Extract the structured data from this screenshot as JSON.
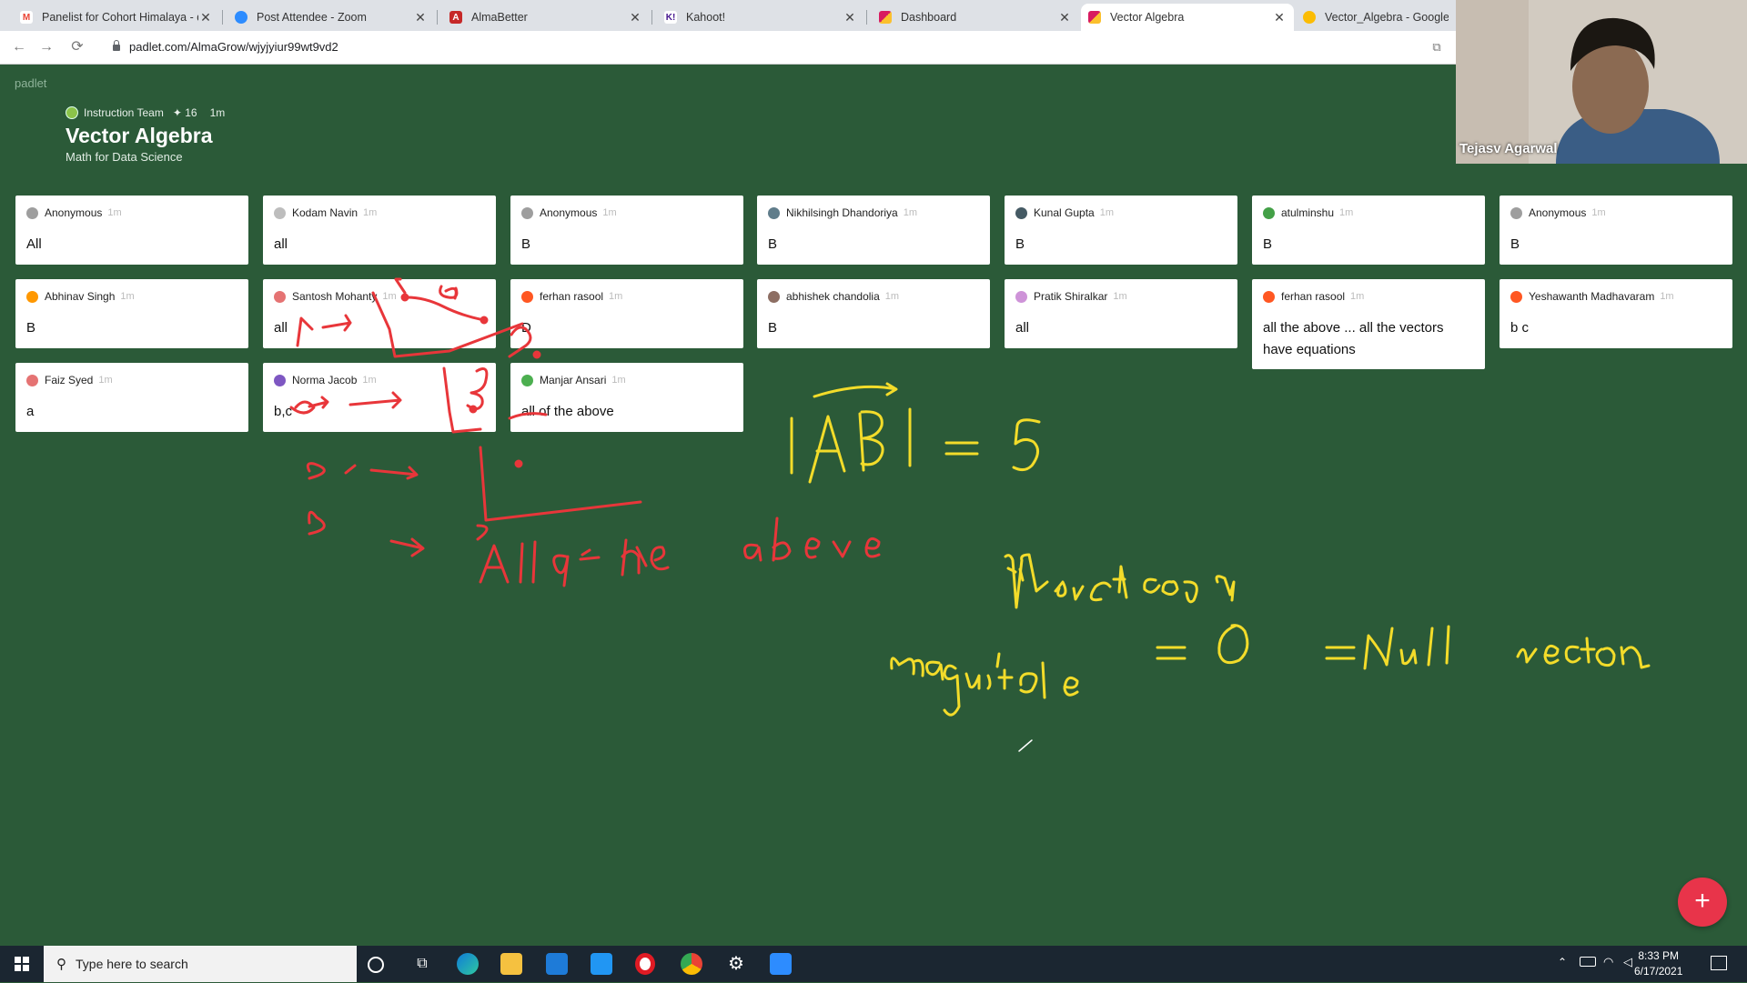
{
  "tabs": [
    {
      "title": "Panelist for Cohort Himalaya - d",
      "color": "#ea4335",
      "glyph": "M"
    },
    {
      "title": "Post Attendee - Zoom",
      "color": "#2d8cff",
      "glyph": ""
    },
    {
      "title": "AlmaBetter",
      "color": "#c62828",
      "glyph": "A"
    },
    {
      "title": "Kahoot!",
      "color": "#46178f",
      "glyph": "K!"
    },
    {
      "title": "Dashboard",
      "color": "#d81b60",
      "glyph": ""
    },
    {
      "title": "Vector Algebra",
      "color": "#d81b60",
      "glyph": ""
    },
    {
      "title": "Vector_Algebra - Google Ja",
      "color": "#fbbc04",
      "glyph": ""
    }
  ],
  "url": "padlet.com/AlmaGrow/wjyjyiur99wt9vd2",
  "padlet": {
    "brand": "padlet",
    "author": "Instruction Team",
    "likes": "✦ 16",
    "time": "1m",
    "title": "Vector Algebra",
    "subtitle": "Math for Data Science"
  },
  "posts": [
    {
      "author": "Anonymous",
      "time": "1m",
      "body": "All",
      "avatar": "#9e9e9e"
    },
    {
      "author": "Kodam Navin",
      "time": "1m",
      "body": "all",
      "avatar": "#bdbdbd"
    },
    {
      "author": "Anonymous",
      "time": "1m",
      "body": "B",
      "avatar": "#9e9e9e"
    },
    {
      "author": "Nikhilsingh Dhandoriya",
      "time": "1m",
      "body": "B",
      "avatar": "#607d8b"
    },
    {
      "author": "Kunal Gupta",
      "time": "1m",
      "body": "B",
      "avatar": "#455a64"
    },
    {
      "author": "atulminshu",
      "time": "1m",
      "body": "B",
      "avatar": "#43a047"
    },
    {
      "author": "Anonymous",
      "time": "1m",
      "body": "B",
      "avatar": "#9e9e9e"
    },
    {
      "author": "Abhinav Singh",
      "time": "1m",
      "body": "B",
      "avatar": "#ff9800"
    },
    {
      "author": "Santosh Mohanty",
      "time": "1m",
      "body": "all",
      "avatar": "#e57373"
    },
    {
      "author": "ferhan rasool",
      "time": "1m",
      "body": "D",
      "avatar": "#ff5722"
    },
    {
      "author": "abhishek chandolia",
      "time": "1m",
      "body": "B",
      "avatar": "#8d6e63"
    },
    {
      "author": "Pratik Shiralkar",
      "time": "1m",
      "body": "all",
      "avatar": "#ce93d8"
    },
    {
      "author": "ferhan rasool",
      "time": "1m",
      "body": "all the above ... all the vectors have equations",
      "avatar": "#ff5722"
    },
    {
      "author": "Yeshawanth Madhavaram",
      "time": "1m",
      "body": "b c",
      "avatar": "#ff5722"
    },
    {
      "author": "Faiz Syed",
      "time": "1m",
      "body": "a",
      "avatar": "#e57373"
    },
    {
      "author": "Norma Jacob",
      "time": "1m",
      "body": "b,c",
      "avatar": "#7e57c2"
    },
    {
      "author": "Manjar Ansari",
      "time": "1m",
      "body": "all of the above",
      "avatar": "#4caf50"
    }
  ],
  "video": {
    "name": "Tejasv Agarwal"
  },
  "fab": "+",
  "taskbar": {
    "search_placeholder": "Type here to search",
    "time": "8:33 PM",
    "date": "6/17/2021"
  },
  "colors": {
    "board": "#2b5a38",
    "red_ink": "#e8363a",
    "yellow_ink": "#f3dc2a",
    "fab": "#e8344a"
  }
}
